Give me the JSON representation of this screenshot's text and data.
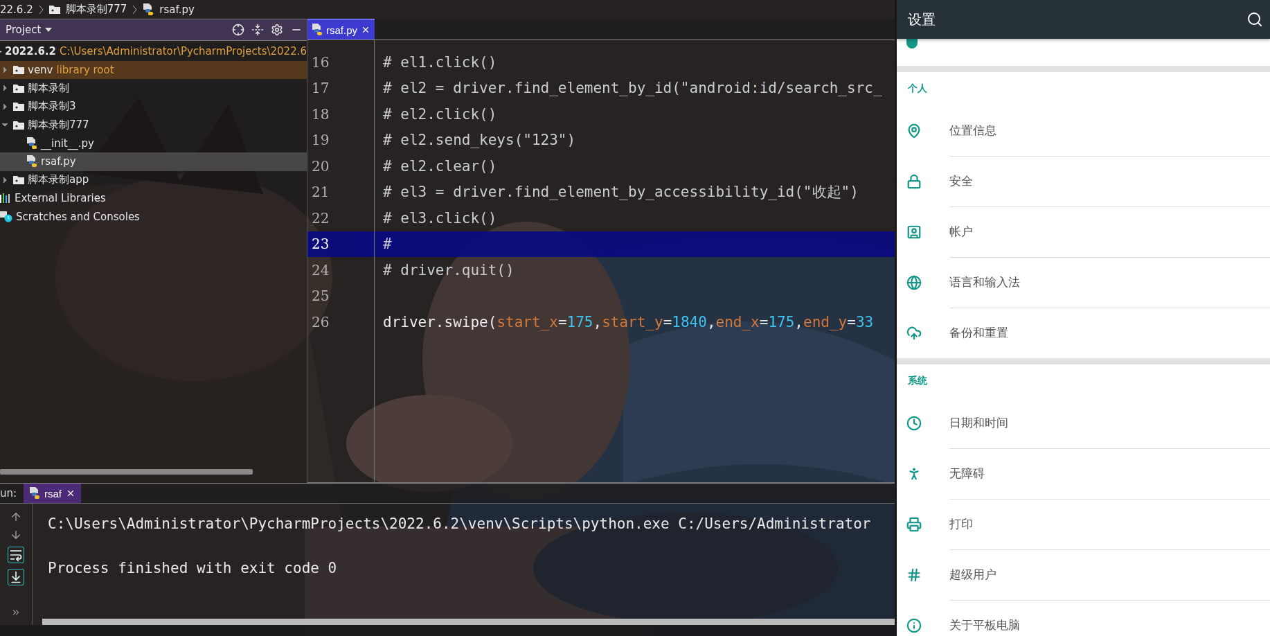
{
  "breadcrumb": [
    {
      "label": "22.6.2",
      "kind": "text"
    },
    {
      "label": "脚本录制777",
      "kind": "folder"
    },
    {
      "label": "rsaf.py",
      "kind": "python"
    }
  ],
  "project_panel": {
    "title": "Project",
    "tree": [
      {
        "label": "2022.6.2",
        "kind": "root",
        "note": "C:\\Users\\Administrator\\PycharmProjects\\2022.6",
        "selected": false,
        "children": [
          {
            "label": "venv",
            "kind": "library_folder",
            "note": "library root",
            "expanded": false,
            "selected": false
          },
          {
            "label": "脚本录制",
            "kind": "folder",
            "expanded": false,
            "selected": false
          },
          {
            "label": "脚本录制3",
            "kind": "folder",
            "expanded": false,
            "selected": false
          },
          {
            "label": "脚本录制777",
            "kind": "folder",
            "expanded": true,
            "selected": false,
            "children": [
              {
                "label": "__init__.py",
                "kind": "python",
                "selected": false
              },
              {
                "label": "rsaf.py",
                "kind": "python",
                "selected": true
              }
            ]
          },
          {
            "label": "脚本录制app",
            "kind": "folder",
            "expanded": false,
            "selected": false
          }
        ]
      },
      {
        "label": "External Libraries",
        "kind": "libraries",
        "selected": false
      },
      {
        "label": "Scratches and Consoles",
        "kind": "scratches",
        "selected": false
      }
    ]
  },
  "editor": {
    "tabs": [
      {
        "label": "rsaf.py",
        "selected": true
      }
    ],
    "lines": [
      {
        "number": "16",
        "selected": false,
        "tokens": [
          {
            "kind": "comment",
            "text": "# el1.click()"
          }
        ]
      },
      {
        "number": "17",
        "selected": false,
        "tokens": [
          {
            "kind": "comment",
            "text": "# el2 = driver.find_element_by_id(\"android:id/search_src_"
          }
        ]
      },
      {
        "number": "18",
        "selected": false,
        "tokens": [
          {
            "kind": "comment",
            "text": "# el2.click()"
          }
        ]
      },
      {
        "number": "19",
        "selected": false,
        "tokens": [
          {
            "kind": "comment",
            "text": "# el2.send_keys(\"123\")"
          }
        ]
      },
      {
        "number": "20",
        "selected": false,
        "tokens": [
          {
            "kind": "comment",
            "text": "# el2.clear()"
          }
        ]
      },
      {
        "number": "21",
        "selected": false,
        "tokens": [
          {
            "kind": "comment",
            "text": "# el3 = driver.find_element_by_accessibility_id(\"收起\")"
          }
        ]
      },
      {
        "number": "22",
        "selected": false,
        "tokens": [
          {
            "kind": "comment",
            "text": "# el3.click()"
          }
        ]
      },
      {
        "number": "23",
        "selected": true,
        "tokens": [
          {
            "kind": "comment",
            "text": "#"
          }
        ]
      },
      {
        "number": "24",
        "selected": false,
        "tokens": [
          {
            "kind": "comment",
            "text": "# driver.quit()"
          }
        ]
      },
      {
        "number": "25",
        "selected": false
      },
      {
        "number": "26",
        "selected": false,
        "tokens": [
          {
            "kind": "plain",
            "text": "driver.swipe("
          },
          {
            "kind": "param",
            "text": "start_x"
          },
          {
            "kind": "plain",
            "text": "="
          },
          {
            "kind": "number",
            "text": "175"
          },
          {
            "kind": "plain",
            "text": ","
          },
          {
            "kind": "param",
            "text": "start_y"
          },
          {
            "kind": "plain",
            "text": "="
          },
          {
            "kind": "number",
            "text": "1840"
          },
          {
            "kind": "plain",
            "text": ","
          },
          {
            "kind": "param",
            "text": "end_x"
          },
          {
            "kind": "plain",
            "text": "="
          },
          {
            "kind": "number",
            "text": "175"
          },
          {
            "kind": "plain",
            "text": ","
          },
          {
            "kind": "param",
            "text": "end_y"
          },
          {
            "kind": "plain",
            "text": "="
          },
          {
            "kind": "number",
            "text": "33"
          }
        ]
      }
    ]
  },
  "run_panel": {
    "label": "un:",
    "tabs": [
      {
        "label": "rsaf",
        "selected": true
      }
    ],
    "output": [
      "C:\\Users\\Administrator\\PycharmProjects\\2022.6.2\\venv\\Scripts\\python.exe C:/Users/Administrator",
      "Process finished with exit code 0"
    ]
  },
  "settings": {
    "title": "设置",
    "sections": [
      {
        "items": [
          {
            "kind": "apps"
          }
        ]
      },
      {
        "header": "个人",
        "items": [
          {
            "label": "位置信息",
            "kind": "location"
          },
          {
            "label": "安全",
            "kind": "lock"
          },
          {
            "label": "帐户",
            "kind": "account"
          },
          {
            "label": "语言和输入法",
            "kind": "globe"
          },
          {
            "label": "备份和重置",
            "kind": "backup"
          }
        ]
      },
      {
        "header": "系统",
        "items": [
          {
            "label": "日期和时间",
            "kind": "clock"
          },
          {
            "label": "无障碍",
            "kind": "accessibility"
          },
          {
            "label": "打印",
            "kind": "print"
          },
          {
            "label": "超级用户",
            "kind": "hash"
          },
          {
            "label": "关于平板电脑",
            "kind": "info"
          }
        ]
      }
    ]
  }
}
